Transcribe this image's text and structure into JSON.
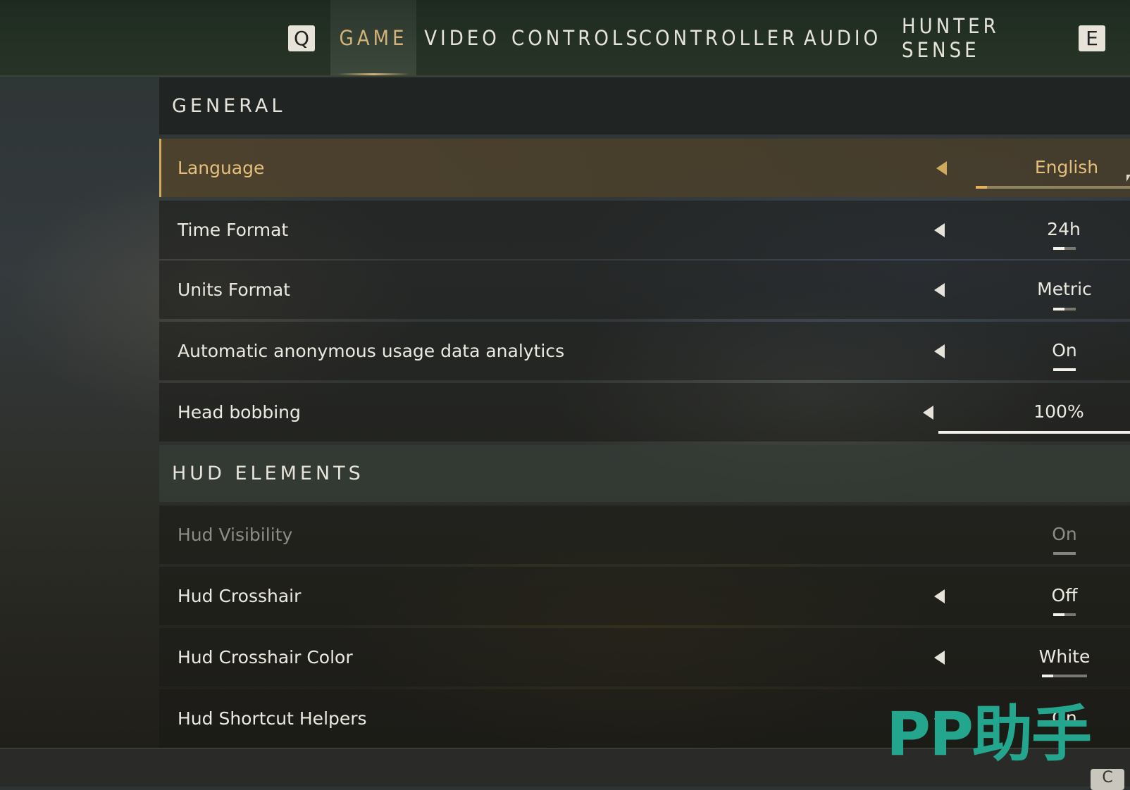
{
  "nav": {
    "prev_key": "Q",
    "next_key": "E",
    "tabs": [
      {
        "label": "GAME",
        "active": true
      },
      {
        "label": "VIDEO",
        "active": false
      },
      {
        "label": "CONTROLS",
        "active": false
      },
      {
        "label": "CONTROLLER",
        "active": false
      },
      {
        "label": "AUDIO",
        "active": false
      },
      {
        "label": "HUNTER SENSE",
        "active": false
      }
    ]
  },
  "sections": {
    "general": {
      "title": "GENERAL",
      "rows": [
        {
          "label": "Language",
          "value": "English",
          "level": 0.07,
          "selected": true
        },
        {
          "label": "Time Format",
          "value": "24h",
          "level": 0.5
        },
        {
          "label": "Units Format",
          "value": "Metric",
          "level": 0.5
        },
        {
          "label": "Automatic anonymous usage data analytics",
          "value": "On",
          "level": 1.0
        },
        {
          "label": "Head bobbing",
          "value": "100%",
          "level": 1.0
        }
      ]
    },
    "hud": {
      "title": "HUD ELEMENTS",
      "rows": [
        {
          "label": "Hud Visibility",
          "value": "On",
          "level": 1.0,
          "disabled": true
        },
        {
          "label": "Hud Crosshair",
          "value": "Off",
          "level": 0.5
        },
        {
          "label": "Hud Crosshair Color",
          "value": "White",
          "level": 0.25
        },
        {
          "label": "Hud Shortcut Helpers",
          "value": "On",
          "level": 1.0
        }
      ]
    }
  },
  "watermark": "PP助手",
  "corner_key": "C",
  "colors": {
    "accent_gold": "#cfa95e",
    "watermark_teal": "#23a68d"
  }
}
